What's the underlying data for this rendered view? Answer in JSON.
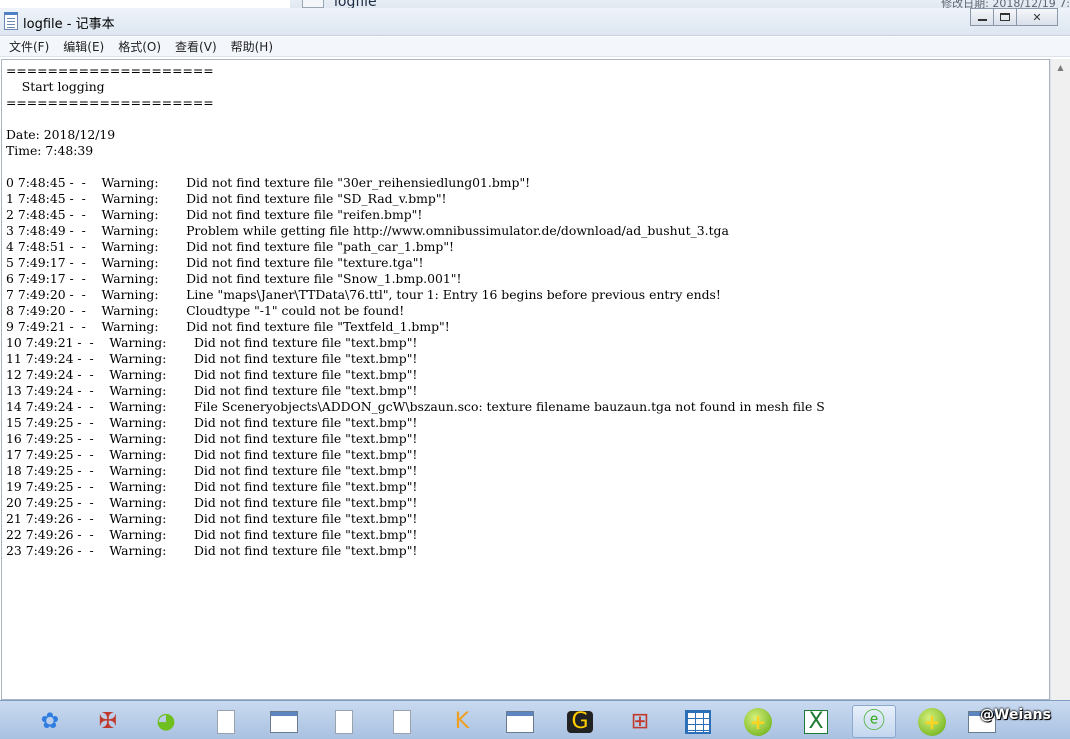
{
  "background_window": {
    "title": "logfile",
    "date_text": "修改日期: 2018/12/19 7:"
  },
  "window": {
    "title": "logfile - 记事本",
    "controls": {
      "minimize": "",
      "maximize": "",
      "close": "✕"
    }
  },
  "menu": [
    "文件(F)",
    "编辑(E)",
    "格式(O)",
    "查看(V)",
    "帮助(H)"
  ],
  "log": {
    "text": "====================\n    Start logging\n====================\n\nDate: 2018/12/19\nTime: 7:48:39\n\n0 7:48:45 -  -    Warning:       Did not find texture file \"30er_reihensiedlung01.bmp\"!\n1 7:48:45 -  -    Warning:       Did not find texture file \"SD_Rad_v.bmp\"!\n2 7:48:45 -  -    Warning:       Did not find texture file \"reifen.bmp\"!\n3 7:48:49 -  -    Warning:       Problem while getting file http://www.omnibussimulator.de/download/ad_bushut_3.tga\n4 7:48:51 -  -    Warning:       Did not find texture file \"path_car_1.bmp\"!\n5 7:49:17 -  -    Warning:       Did not find texture file \"texture.tga\"!\n6 7:49:17 -  -    Warning:       Did not find texture file \"Snow_1.bmp.001\"!\n7 7:49:20 -  -    Warning:       Line \"maps\\Janer\\TTData\\76.ttl\", tour 1: Entry 16 begins before previous entry ends!\n8 7:49:20 -  -    Warning:       Cloudtype \"-1\" could not be found!\n9 7:49:21 -  -    Warning:       Did not find texture file \"Textfeld_1.bmp\"!\n10 7:49:21 -  -    Warning:       Did not find texture file \"text.bmp\"!\n11 7:49:24 -  -    Warning:       Did not find texture file \"text.bmp\"!\n12 7:49:24 -  -    Warning:       Did not find texture file \"text.bmp\"!\n13 7:49:24 -  -    Warning:       Did not find texture file \"text.bmp\"!\n14 7:49:24 -  -    Warning:       File Sceneryobjects\\ADDON_gcW\\bszaun.sco: texture filename bauzaun.tga not found in mesh file S\n15 7:49:25 -  -    Warning:       Did not find texture file \"text.bmp\"!\n16 7:49:25 -  -    Warning:       Did not find texture file \"text.bmp\"!\n17 7:49:25 -  -    Warning:       Did not find texture file \"text.bmp\"!\n18 7:49:25 -  -    Warning:       Did not find texture file \"text.bmp\"!\n19 7:49:25 -  -    Warning:       Did not find texture file \"text.bmp\"!\n20 7:49:25 -  -    Warning:       Did not find texture file \"text.bmp\"!\n21 7:49:26 -  -    Warning:       Did not find texture file \"text.bmp\"!\n22 7:49:26 -  -    Warning:       Did not find texture file \"text.bmp\"!\n23 7:49:26 -  -    Warning:       Did not find texture file \"text.bmp\"!"
  },
  "taskbar": {
    "items": [
      "baidu-netdisk-icon",
      "game-icon",
      "pacman-icon",
      "document-icon",
      "window-icon",
      "document-icon",
      "document-icon",
      "kingsoft-icon",
      "window-icon",
      "g-app-icon",
      "toolbox-icon",
      "grid-icon",
      "green-plus-icon",
      "excel-icon",
      "green-e-icon",
      "green-plus-icon",
      "window-icon"
    ],
    "tray_text": "@Weians"
  }
}
